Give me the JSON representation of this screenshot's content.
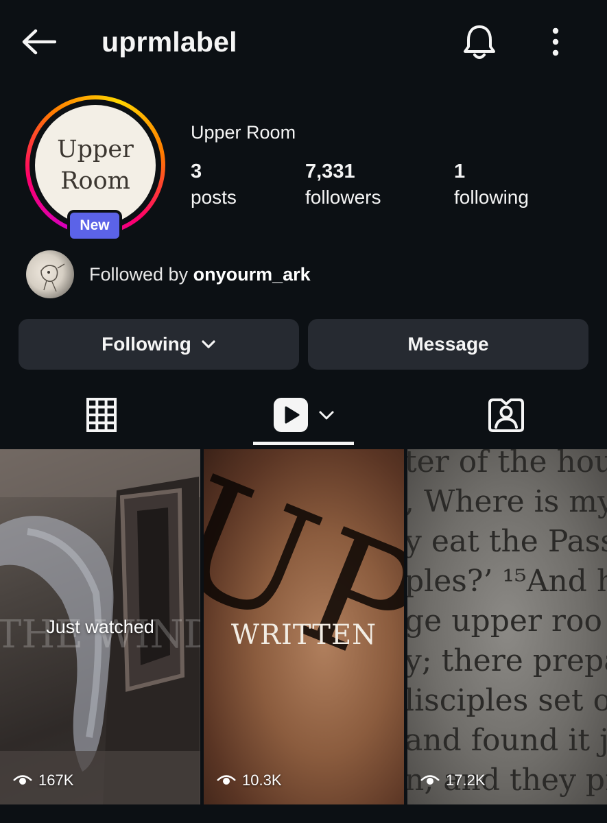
{
  "header": {
    "username": "uprmlabel",
    "back_icon": "arrow-left-icon",
    "bell_icon": "bell-icon",
    "more_icon": "more-vertical-icon"
  },
  "profile": {
    "avatar_text": [
      "Upper",
      "Room"
    ],
    "badge": "New",
    "display_name": "Upper Room",
    "stats": [
      {
        "value": "3",
        "label": "posts"
      },
      {
        "value": "7,331",
        "label": "followers"
      },
      {
        "value": "1",
        "label": "following"
      }
    ],
    "followed_by_prefix": "Followed by ",
    "followed_by_user": "onyourm_ark"
  },
  "actions": {
    "following_label": "Following",
    "message_label": "Message"
  },
  "tabs": [
    {
      "icon": "grid-icon",
      "active": false
    },
    {
      "icon": "reels-icon",
      "active": true
    },
    {
      "icon": "tagged-icon",
      "active": false
    }
  ],
  "tiles": [
    {
      "overlay": "Just watched",
      "background_text": "THE WIND",
      "views": "167K"
    },
    {
      "title": "WRITTEN",
      "background_text": "UPPER",
      "views": "10.3K"
    },
    {
      "background_lines": [
        "ter of the hou",
        ", Where is my",
        "y eat the Pass",
        "ples?’ ¹⁵And h",
        "ge upper roo",
        "y; there prepa",
        "lisciples set o",
        "and found it j",
        "n, and they pr"
      ],
      "views": "17.2K"
    }
  ],
  "colors": {
    "background": "#0c1014",
    "button": "#262a31",
    "badge": "#5b63e8",
    "text": "#f5f5f5"
  }
}
